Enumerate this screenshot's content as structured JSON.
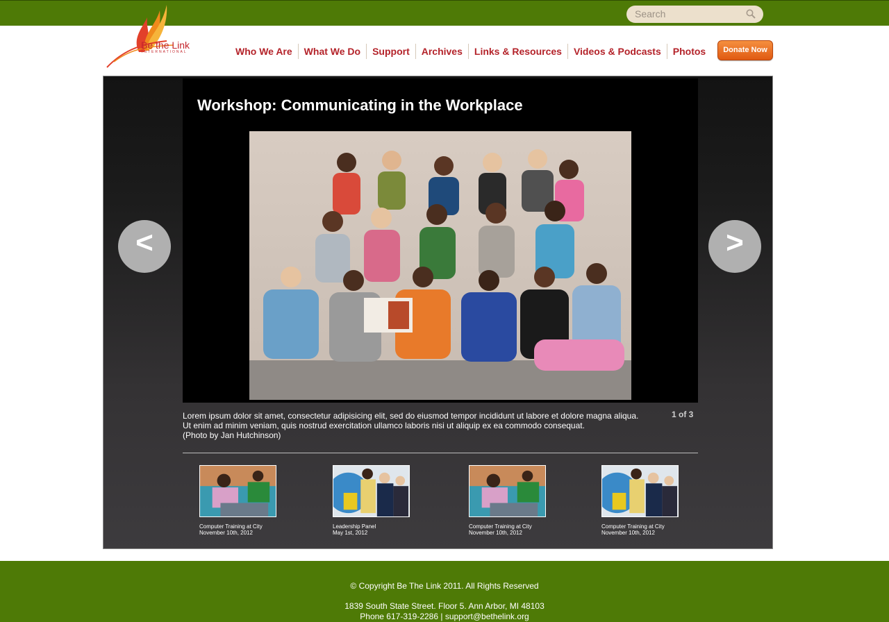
{
  "header": {
    "search_placeholder": "Search",
    "logo_text": "Be the Link",
    "logo_subtext": "INTERNATIONAL",
    "nav": [
      "Who We Are",
      "What We Do",
      "Support",
      "Archives",
      "Links & Resources",
      "Videos & Podcasts",
      "Photos"
    ],
    "donate_label": "Donate Now"
  },
  "gallery": {
    "title": "Workshop: Communicating in the Workplace",
    "prev_label": "<",
    "next_label": ">",
    "caption_line1": "Lorem ipsum dolor sit amet, consectetur adipisicing elit, sed do eiusmod tempor incididunt ut labore et dolore magna aliqua.",
    "caption_line2": "Ut enim ad minim veniam, quis nostrud exercitation ullamco laboris nisi ut aliquip ex ea commodo consequat.",
    "caption_credit": "(Photo by Jan Hutchinson)",
    "counter": "1 of 3",
    "thumbnails": [
      {
        "title": "Computer Training at City",
        "date": "November 10th, 2012"
      },
      {
        "title": "Leadership Panel",
        "date": "May 1st, 2012"
      },
      {
        "title": "Computer Training at City",
        "date": "November 10th, 2012"
      },
      {
        "title": "Computer Training at City",
        "date": "November 10th, 2012"
      }
    ]
  },
  "footer": {
    "copyright": "© Copyright Be The Link 2011. All Rights Reserved",
    "address": "1839 South State Street. Floor 5. Ann Arbor, MI 48103",
    "contact": "Phone 617-319-2286 | support@bethelink.org"
  },
  "colors": {
    "brand_green": "#4e7a06",
    "nav_red": "#b4232a",
    "donate_orange": "#e86a1c"
  }
}
